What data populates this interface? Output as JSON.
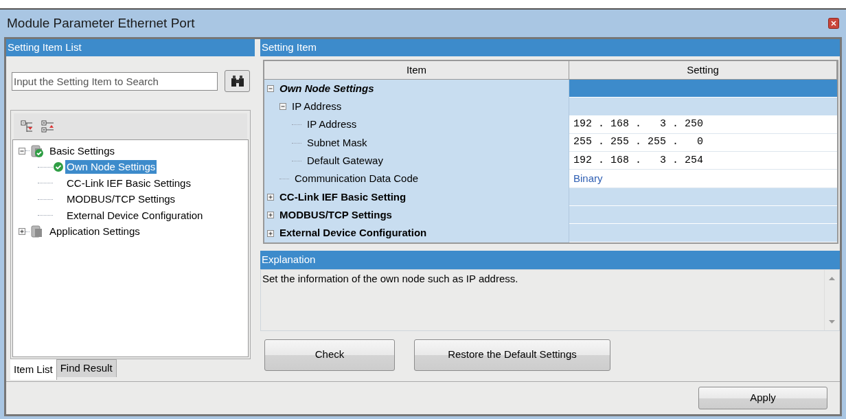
{
  "window": {
    "title": "Module Parameter Ethernet Port"
  },
  "left_panel": {
    "header": "Setting Item List",
    "search": {
      "placeholder": "Input the Setting Item to Search"
    },
    "tree": [
      {
        "label": "Basic Settings",
        "kind": "folder",
        "checked": true,
        "expanded": true,
        "selected": false,
        "children": [
          {
            "label": "Own Node Settings",
            "kind": "leaf",
            "checked": true,
            "selected": true
          },
          {
            "label": "CC-Link IEF Basic Settings",
            "kind": "leaf",
            "checked": false,
            "selected": false
          },
          {
            "label": "MODBUS/TCP Settings",
            "kind": "leaf",
            "checked": false,
            "selected": false
          },
          {
            "label": "External Device Configuration",
            "kind": "leaf",
            "checked": false,
            "selected": false
          }
        ]
      },
      {
        "label": "Application Settings",
        "kind": "folder",
        "checked": false,
        "expanded": false,
        "selected": false
      }
    ],
    "tabs": [
      {
        "label": "Item List",
        "selected": true
      },
      {
        "label": "Find Result",
        "selected": false
      }
    ]
  },
  "setting_item": {
    "header": "Setting Item",
    "columns": [
      "Item",
      "Setting"
    ],
    "rows": [
      {
        "item": "Own Node Settings",
        "kind": "group",
        "expanded": true,
        "selected": true,
        "children": [
          {
            "item": "IP Address",
            "kind": "group",
            "expanded": true,
            "selected": false,
            "children": [
              {
                "item": "IP Address",
                "kind": "ip",
                "setting": "192 . 168 .   3 . 250"
              },
              {
                "item": "Subnet Mask",
                "kind": "ip",
                "setting": "255 . 255 . 255 .   0"
              },
              {
                "item": "Default Gateway",
                "kind": "ip",
                "setting": "192 . 168 .   3 . 254"
              }
            ]
          },
          {
            "item": "Communication Data Code",
            "kind": "select",
            "setting": "Binary"
          }
        ]
      },
      {
        "item": "CC-Link IEF Basic Setting",
        "kind": "group",
        "expanded": false,
        "selected": false
      },
      {
        "item": "MODBUS/TCP Settings",
        "kind": "group",
        "expanded": false,
        "selected": false
      },
      {
        "item": "External Device Configuration",
        "kind": "group",
        "expanded": false,
        "selected": false
      }
    ]
  },
  "explanation": {
    "header": "Explanation",
    "text": "Set the information of the own node such as IP address."
  },
  "buttons": [
    "Check",
    "Restore the Default Settings"
  ],
  "footer": {
    "button": "Apply"
  }
}
